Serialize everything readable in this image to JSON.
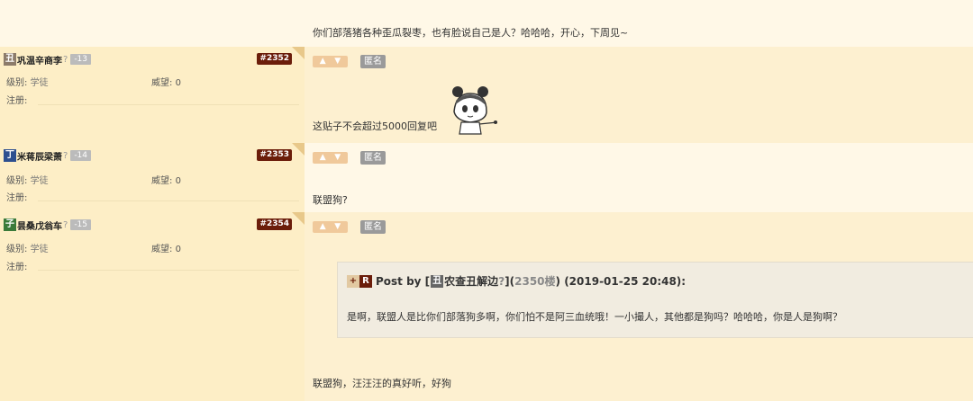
{
  "top_message": "你们部落猪各种歪瓜裂枣，也有脸说自己是人？哈哈哈，开心，下周见~",
  "labels": {
    "level": "级别:",
    "prestige": "威望:",
    "register": "注册:",
    "anon": "匿名",
    "question": "?"
  },
  "posts": [
    {
      "avatar": "丑",
      "avatar_color": "#8c7b6a",
      "username": "巩温辛商李",
      "score": "-13",
      "floor": "#2352",
      "level": "学徒",
      "prestige": "0",
      "content": "这贴子不会超过5000回复吧"
    },
    {
      "avatar": "丁",
      "avatar_color": "#2d4f8f",
      "username": "米蒋辰梁萧",
      "score": "-14",
      "floor": "#2353",
      "level": "学徒",
      "prestige": "0",
      "content": "联盟狗?"
    },
    {
      "avatar": "子",
      "avatar_color": "#3a7a3a",
      "username": "昙桑戊翁车",
      "score": "-15",
      "floor": "#2354",
      "level": "学徒",
      "prestige": "0",
      "content": "联盟狗，汪汪汪的真好听，好狗",
      "quote": {
        "prefix": "Post by [",
        "user_avatar": "丑",
        "user": "农查丑解边",
        "user_q": "?",
        "suffix": "](",
        "floor_ref": "2350楼",
        "date": ") (2019-01-25 20:48):",
        "body": "是啊，联盟人是比你们部落狗多啊，你们怕不是阿三血统哦！一小撮人，其他都是狗吗？哈哈哈，你是人是狗啊？"
      }
    }
  ],
  "icons": {
    "plus": "+",
    "reply": "R",
    "thumb_up": "👍",
    "thumb_down": "👎"
  }
}
